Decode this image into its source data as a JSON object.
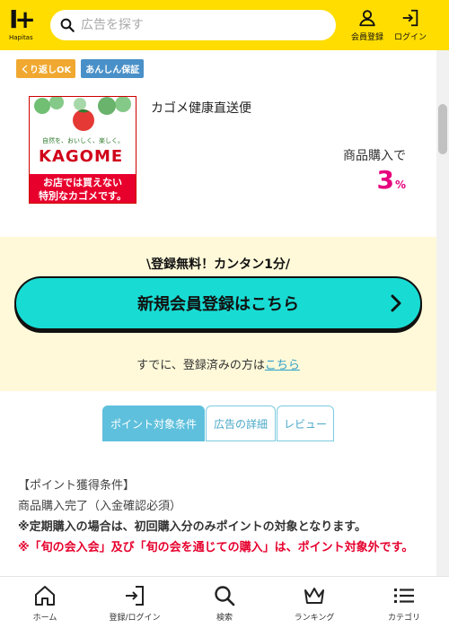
{
  "header": {
    "logo_mark": "I+",
    "logo_text": "Hapitas",
    "search_placeholder": "広告を探す",
    "member_label": "会員登録",
    "login_label": "ログイン",
    "bg_color": "#ffdd00"
  },
  "badges": [
    "くり返しOK",
    "あんしん保証"
  ],
  "product": {
    "name": "カゴメ健康直送便",
    "image_slogan": "自然を、おいしく、楽しく。",
    "image_logo": "KAGOME",
    "image_caption_1": "お店では買えない",
    "image_caption_2": "特別なカゴメです。",
    "reward_label": "商品購入で",
    "reward_value": "3",
    "reward_unit": "%"
  },
  "register": {
    "catch": "\\登録無料！カンタン1分/",
    "button_label": "新規会員登録はこちら",
    "login_prefix": "すでに、登録済みの方は",
    "login_link": "こちら"
  },
  "tabs": [
    "ポイント対象条件",
    "広告の詳細",
    "レビュー"
  ],
  "conditions": {
    "heading": "【ポイント獲得条件】",
    "line1": "商品購入完了（入金確認必須）",
    "note": "※定期購入の場合は、初回購入分のみポイントの対象となります。",
    "warn": "※「旬の会入会」及び「旬の会を通じての購入」は、ポイント対象外です。"
  },
  "bottom_nav": {
    "home": "ホーム",
    "login": "登録/ログイン",
    "search": "検索",
    "ranking": "ランキング",
    "category": "カテゴリ"
  },
  "colors": {
    "accent": "#18dcd4",
    "reward": "#e6007e",
    "warn": "#e6002d",
    "tab": "#5ec0dc"
  }
}
